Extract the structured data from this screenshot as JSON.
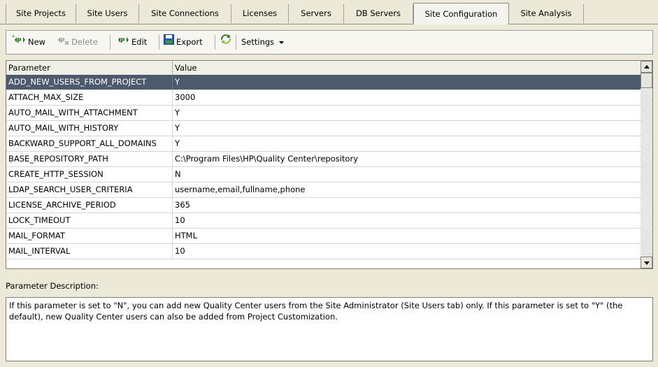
{
  "tabs": [
    {
      "label": "Site Projects",
      "active": false
    },
    {
      "label": "Site Users",
      "active": false
    },
    {
      "label": "Site Connections",
      "active": false
    },
    {
      "label": "Licenses",
      "active": false
    },
    {
      "label": "Servers",
      "active": false
    },
    {
      "label": "DB Servers",
      "active": false
    },
    {
      "label": "Site Configuration",
      "active": true
    },
    {
      "label": "Site Analysis",
      "active": false
    }
  ],
  "toolbar": {
    "new_label": "New",
    "delete_label": "Delete",
    "edit_label": "Edit",
    "export_label": "Export",
    "settings_label": "Settings"
  },
  "grid": {
    "headers": {
      "parameter": "Parameter",
      "value": "Value"
    },
    "rows": [
      {
        "parameter": "ADD_NEW_USERS_FROM_PROJECT",
        "value": "Y",
        "selected": true
      },
      {
        "parameter": "ATTACH_MAX_SIZE",
        "value": "3000"
      },
      {
        "parameter": "AUTO_MAIL_WITH_ATTACHMENT",
        "value": "Y"
      },
      {
        "parameter": "AUTO_MAIL_WITH_HISTORY",
        "value": "Y"
      },
      {
        "parameter": "BACKWARD_SUPPORT_ALL_DOMAINS",
        "value": "Y"
      },
      {
        "parameter": "BASE_REPOSITORY_PATH",
        "value": "C:\\Program Files\\HP\\Quality Center\\repository"
      },
      {
        "parameter": "CREATE_HTTP_SESSION",
        "value": "N"
      },
      {
        "parameter": "LDAP_SEARCH_USER_CRITERIA",
        "value": "username,email,fullname,phone"
      },
      {
        "parameter": "LICENSE_ARCHIVE_PERIOD",
        "value": "365"
      },
      {
        "parameter": "LOCK_TIMEOUT",
        "value": "10"
      },
      {
        "parameter": "MAIL_FORMAT",
        "value": "HTML"
      },
      {
        "parameter": "MAIL_INTERVAL",
        "value": "10"
      }
    ]
  },
  "description": {
    "label": "Parameter Description:",
    "text": "If this parameter is set to \"N\", you can add new Quality Center users from the Site Administrator (Site Users tab) only. If this parameter is set to \"Y\" (the default), new Quality Center users can also be added from Project Customization."
  },
  "colors": {
    "selection": "#4d5a6d",
    "window_bg": "#ece9d8"
  }
}
